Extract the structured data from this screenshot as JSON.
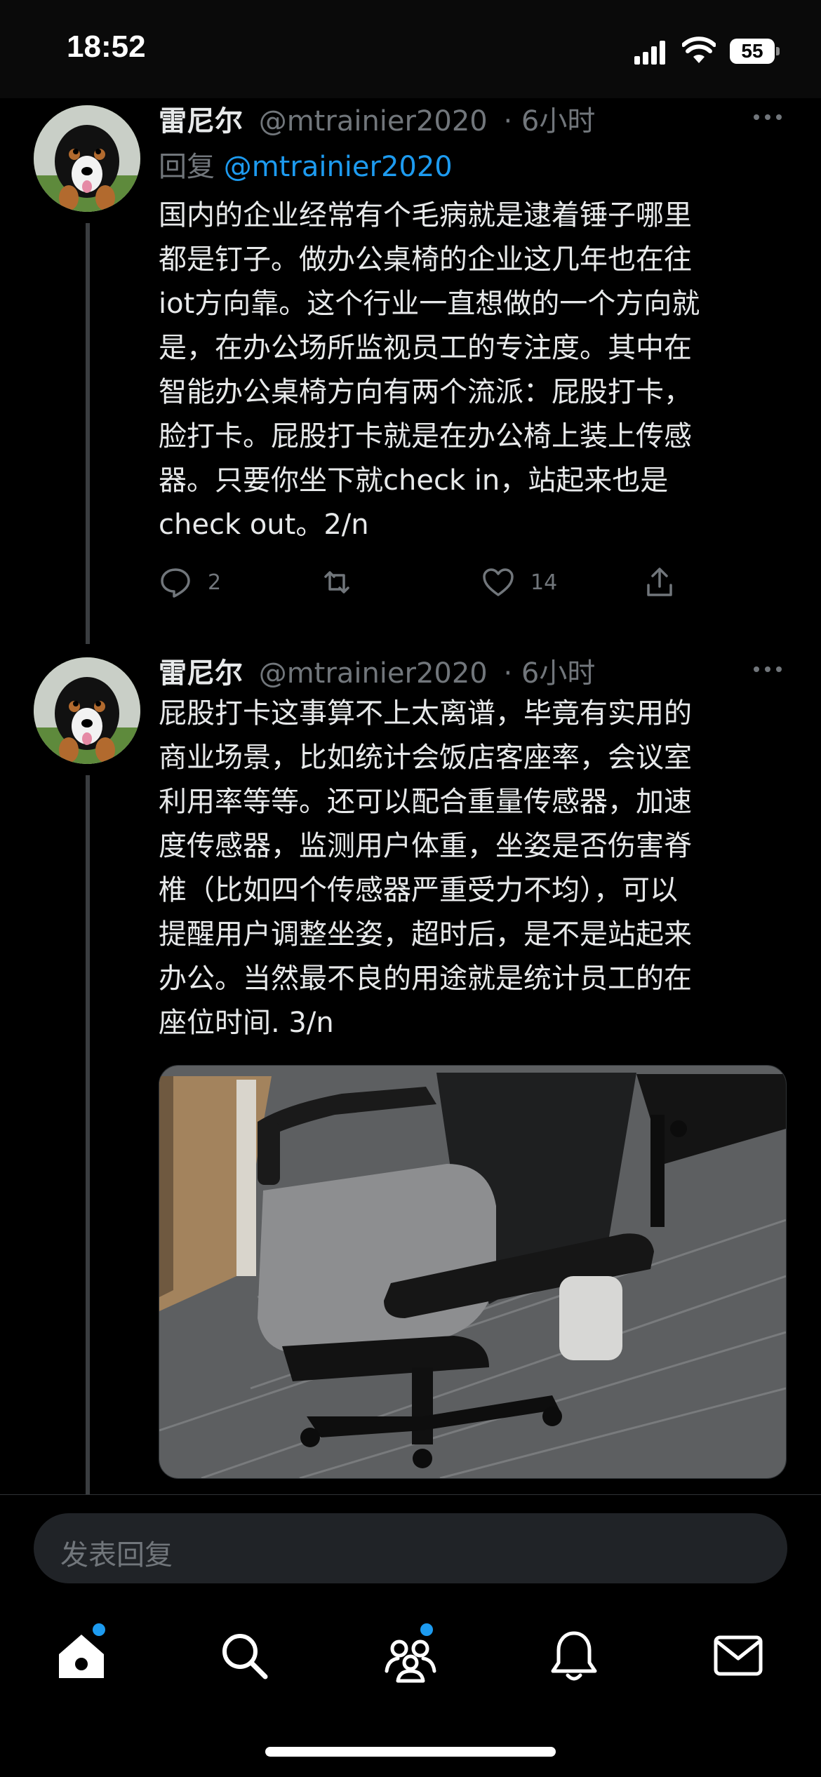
{
  "status_bar": {
    "time": "18:52",
    "battery": "55"
  },
  "tweets": [
    {
      "name": "雷尼尔",
      "handle": "@mtrainier2020",
      "time": "· 6小时",
      "reply_prefix": "回复",
      "reply_mention": "@mtrainier2020",
      "text": "国内的企业经常有个毛病就是逮着锤子哪里\n都是钉子。做办公桌椅的企业这几年也在往\niot方向靠。这个行业一直想做的一个方向就\n是，在办公场所监视员工的专注度。其中在\n智能办公桌椅方向有两个流派：屁股打卡，\n脸打卡。屁股打卡就是在办公椅上装上传感\n器。只要你坐下就check in，站起来也是\ncheck out。2/n",
      "replies": "2",
      "likes": "14"
    },
    {
      "name": "雷尼尔",
      "handle": "@mtrainier2020",
      "time": "· 6小时",
      "text": "屁股打卡这事算不上太离谱，毕竟有实用的\n商业场景，比如统计会饭店客座率，会议室\n利用率等等。还可以配合重量传感器，加速\n度传感器，监测用户体重，坐姿是否伤害脊\n椎（比如四个传感器严重受力不均），可以\n提醒用户调整坐姿，超时后，是不是站起来\n办公。当然最不良的用途就是统计员工的在\n座位时间. 3/n"
    }
  ],
  "composer": {
    "placeholder": "发表回复"
  },
  "nav": [
    "home-icon",
    "search-icon",
    "communities-icon",
    "notifications-icon",
    "messages-icon"
  ],
  "colors": {
    "accent": "#1d9bf0",
    "muted": "#71767b",
    "background": "#000000",
    "text": "#e7e9ea"
  }
}
